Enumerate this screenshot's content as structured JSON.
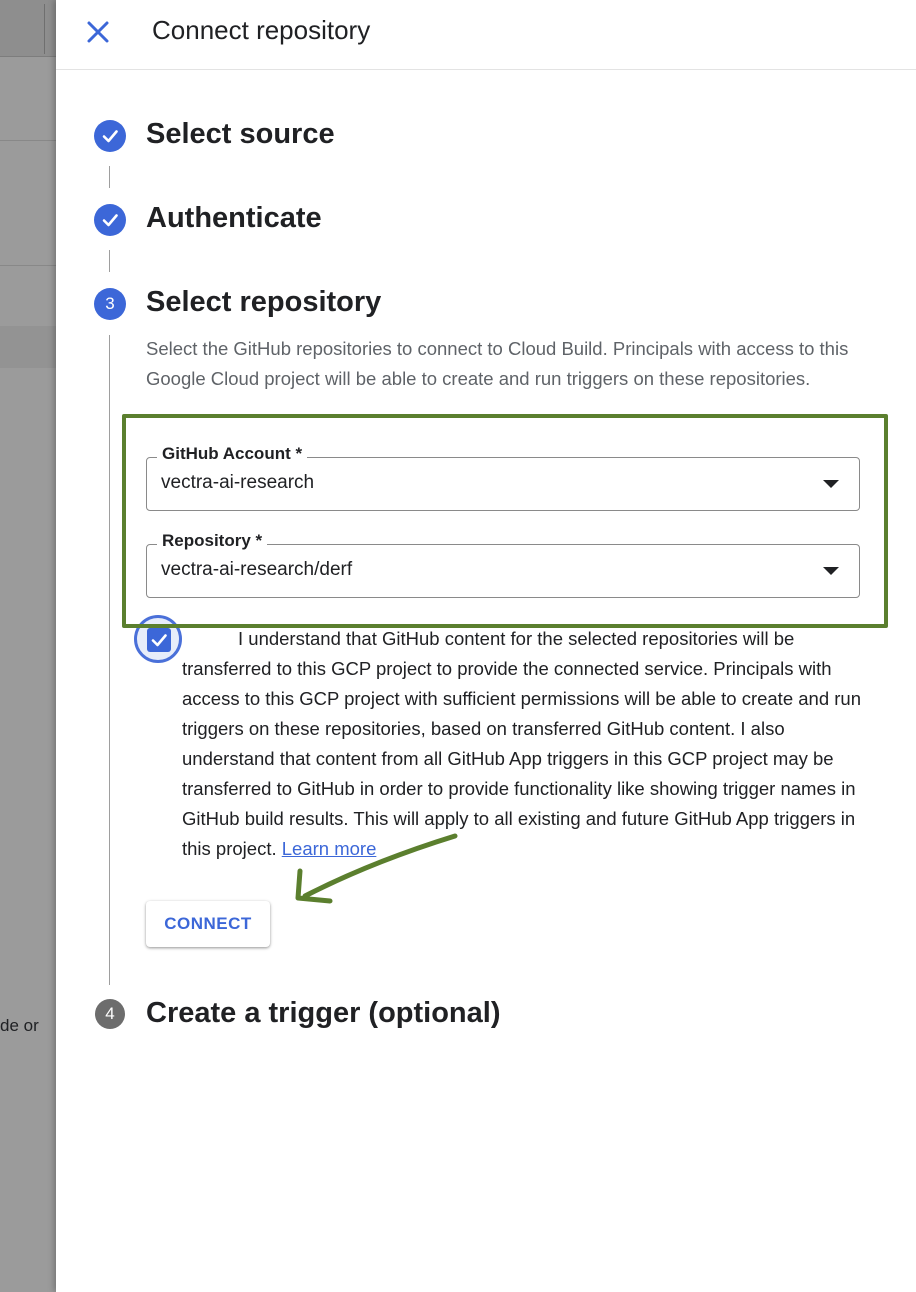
{
  "background": {
    "partial_text": "de or"
  },
  "header": {
    "title": "Connect repository",
    "close_icon": "close-icon"
  },
  "steps": [
    {
      "icon": "check-icon",
      "title": "Select source",
      "state": "done"
    },
    {
      "icon": "check-icon",
      "title": "Authenticate",
      "state": "done"
    },
    {
      "number": "3",
      "title": "Select repository",
      "state": "active"
    },
    {
      "number": "4",
      "title": "Create a trigger (optional)",
      "state": "pending"
    }
  ],
  "select_repository": {
    "description": "Select the GitHub repositories to connect to Cloud Build. Principals with access to this Google Cloud project will be able to create and run triggers on these repositories.",
    "github_account": {
      "label": "GitHub Account *",
      "value": "vectra-ai-research"
    },
    "repository": {
      "label": "Repository *",
      "value": "vectra-ai-research/derf"
    },
    "consent": {
      "checked": true,
      "text": "I understand that GitHub content for the selected repositories will be transferred to this GCP project to provide the connected service. Principals with access to this GCP project with sufficient permissions will be able to create and run triggers on these repositories, based on transferred GitHub content. I also understand that content from all GitHub App triggers in this GCP project may be transferred to GitHub in order to provide functionality like showing trigger names in GitHub build results. This will apply to all existing and future GitHub App triggers in this project.",
      "link_label": "Learn more"
    },
    "connect_label": "CONNECT"
  },
  "colors": {
    "accent": "#3c67d8",
    "annotation": "#5b7f2e",
    "pending_step": "#6d6d6d"
  }
}
